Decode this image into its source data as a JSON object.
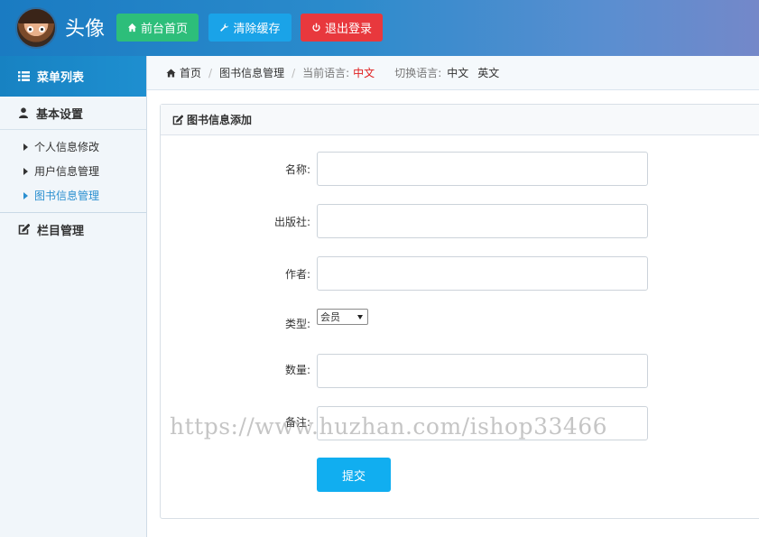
{
  "header": {
    "brand": "头像",
    "buttons": [
      {
        "label": "前台首页",
        "icon": "home-icon",
        "color": "#2dbe7a"
      },
      {
        "label": "清除缓存",
        "icon": "wrench-icon",
        "color": "#1aa3e8"
      },
      {
        "label": "退出登录",
        "icon": "power-icon",
        "color": "#e8383d"
      }
    ]
  },
  "sidebar": {
    "title": "菜单列表",
    "groups": [
      {
        "label": "基本设置",
        "icon": "user-icon",
        "items": [
          "个人信息修改",
          "用户信息管理",
          "图书信息管理"
        ],
        "active_index": 2
      },
      {
        "label": "栏目管理",
        "icon": "edit-icon"
      }
    ]
  },
  "breadcrumb": {
    "home": "首页",
    "page": "图书信息管理",
    "current_lang_label": "当前语言:",
    "current_lang": "中文",
    "switch_label": "切换语言:",
    "lang_zh": "中文",
    "lang_en": "英文"
  },
  "form": {
    "title": "图书信息添加",
    "fields": [
      {
        "label": "名称:",
        "value": ""
      },
      {
        "label": "出版社:",
        "value": ""
      },
      {
        "label": "作者:",
        "value": ""
      },
      {
        "label": "类型:",
        "value": "会员"
      },
      {
        "label": "数量:",
        "value": ""
      },
      {
        "label": "备注:",
        "value": ""
      }
    ],
    "submit": "提交"
  },
  "watermark": "https://www.huzhan.com/ishop33466",
  "colors": {
    "accent": "#1e8fd0",
    "active_link": "#2a8fd0",
    "submit": "#11aef0",
    "lang_active": "#e02020"
  }
}
